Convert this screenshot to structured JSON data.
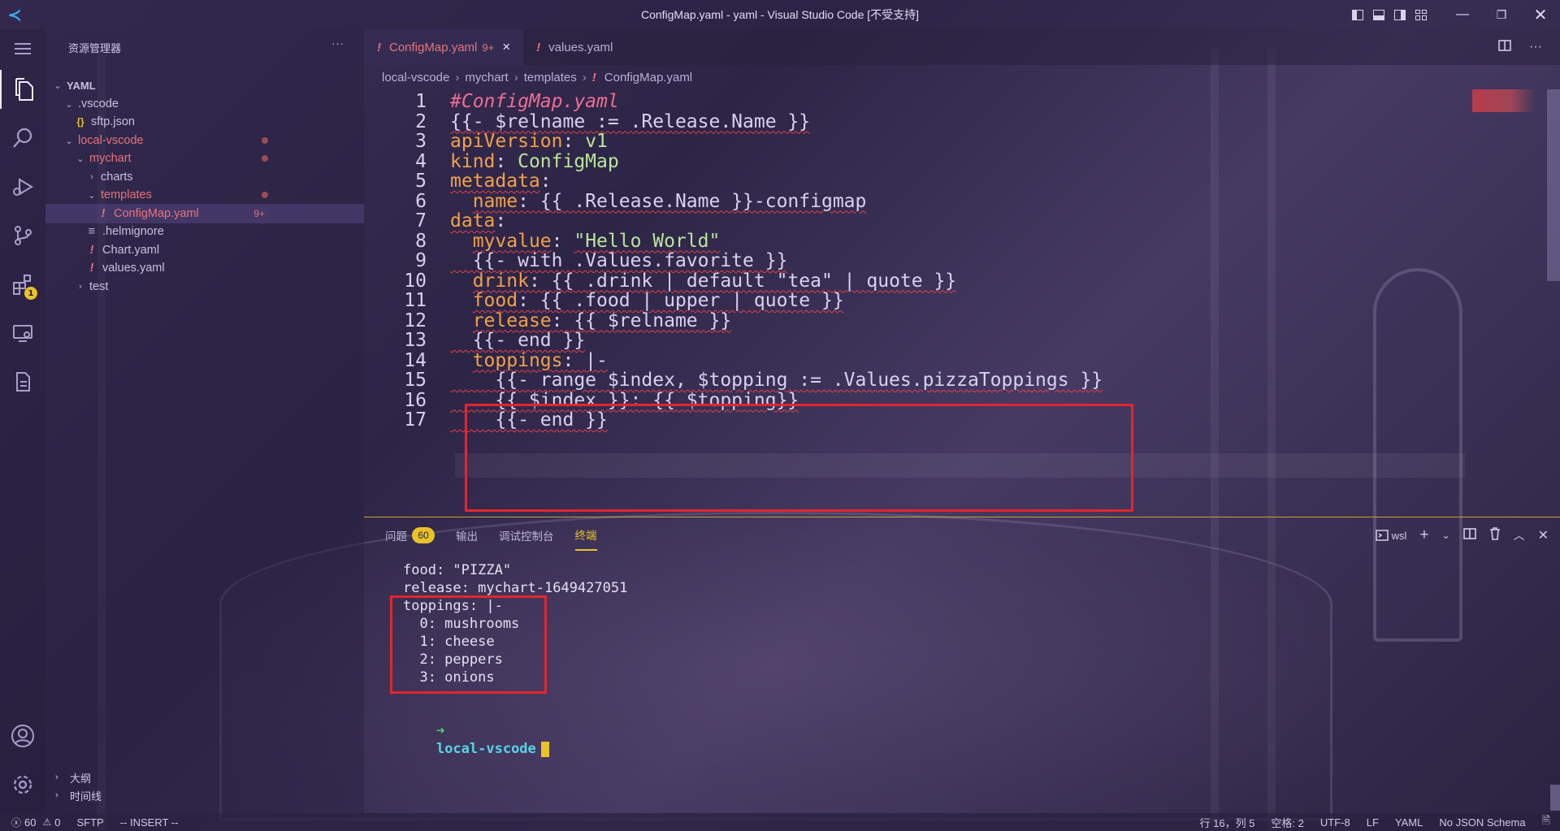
{
  "window": {
    "title": "ConfigMap.yaml - yaml - Visual Studio Code [不受支持]"
  },
  "sidebar": {
    "header": "资源管理器",
    "more": "···",
    "tree": [
      {
        "label": "YAML",
        "chevron": "down"
      },
      {
        "label": ".vscode",
        "chevron": "down"
      },
      {
        "label": "sftp.json",
        "icon": "{}"
      },
      {
        "label": "local-vscode",
        "chevron": "down",
        "modified": true
      },
      {
        "label": "mychart",
        "chevron": "down",
        "modified": true
      },
      {
        "label": "charts",
        "chevron": "right"
      },
      {
        "label": "templates",
        "chevron": "down",
        "modified": true
      },
      {
        "label": "ConfigMap.yaml",
        "icon": "!",
        "count": "9+"
      },
      {
        "label": ".helmignore",
        "icon": "≡"
      },
      {
        "label": "Chart.yaml",
        "icon": "!"
      },
      {
        "label": "values.yaml",
        "icon": "!"
      },
      {
        "label": "test",
        "chevron": "right"
      }
    ],
    "outline": "大纲",
    "timeline": "时间线"
  },
  "activity": {
    "extensions_badge": "1"
  },
  "tabs": [
    {
      "label": "ConfigMap.yaml",
      "modified": "9+",
      "close": "×"
    },
    {
      "label": "values.yaml"
    }
  ],
  "breadcrumb": [
    "local-vscode",
    "mychart",
    "templates",
    "ConfigMap.yaml"
  ],
  "code": {
    "line_numbers": [
      "1",
      "2",
      "3",
      "4",
      "5",
      "6",
      "7",
      "8",
      "9",
      "10",
      "11",
      "12",
      "13",
      "14",
      "15",
      "16",
      "17"
    ],
    "lines": [
      [
        {
          "c": "cmt",
          "t": "#ConfigMap.yaml"
        }
      ],
      [
        {
          "c": "t",
          "t": "{{- $relname := .Release.Name }}",
          "sq": true
        }
      ],
      [
        {
          "c": "k",
          "t": "apiVersion"
        },
        {
          "c": "t",
          "t": ": "
        },
        {
          "c": "v",
          "t": "v1"
        }
      ],
      [
        {
          "c": "k",
          "t": "kind"
        },
        {
          "c": "t",
          "t": ": "
        },
        {
          "c": "v",
          "t": "ConfigMap"
        }
      ],
      [
        {
          "c": "k",
          "t": "metadata",
          "sq": true
        },
        {
          "c": "t",
          "t": ":"
        }
      ],
      [
        {
          "c": "t",
          "t": "  "
        },
        {
          "c": "k",
          "t": "name",
          "sq": true
        },
        {
          "c": "t",
          "t": ": {{ .Release.Name }}-configmap",
          "sq": true
        }
      ],
      [
        {
          "c": "k",
          "t": "data",
          "sq": true
        },
        {
          "c": "t",
          "t": ":"
        }
      ],
      [
        {
          "c": "t",
          "t": "  "
        },
        {
          "c": "k",
          "t": "myvalue",
          "sq": true
        },
        {
          "c": "t",
          "t": ": "
        },
        {
          "c": "v",
          "t": "\"Hello World\"",
          "sq": true
        }
      ],
      [
        {
          "c": "t",
          "t": "  {{- with .Values.favorite }}",
          "sq": true
        }
      ],
      [
        {
          "c": "t",
          "t": "  "
        },
        {
          "c": "k",
          "t": "drink",
          "sq": true
        },
        {
          "c": "t",
          "t": ": {{ .drink | default \"tea\" | quote }}",
          "sq": true
        }
      ],
      [
        {
          "c": "t",
          "t": "  "
        },
        {
          "c": "k",
          "t": "food",
          "sq": true
        },
        {
          "c": "t",
          "t": ": {{ .food | upper | quote }}",
          "sq": true
        }
      ],
      [
        {
          "c": "t",
          "t": "  "
        },
        {
          "c": "k",
          "t": "release",
          "sq": true
        },
        {
          "c": "t",
          "t": ": {{ $relname }}",
          "sq": true
        }
      ],
      [
        {
          "c": "t",
          "t": "  {{- end }}",
          "sq": true
        }
      ],
      [
        {
          "c": "t",
          "t": "  "
        },
        {
          "c": "k",
          "t": "toppings",
          "sq": true
        },
        {
          "c": "t",
          "t": ": |-",
          "sq": true
        }
      ],
      [
        {
          "c": "t",
          "t": "    {{- range $index, $topping := .Values.pizzaToppings }}",
          "sq": true
        }
      ],
      [
        {
          "c": "t",
          "t": "    {{ $index }}: {{ $topping}}",
          "sq": true
        }
      ],
      [
        {
          "c": "t",
          "t": "    {{- end }}",
          "sq": true
        }
      ]
    ]
  },
  "panel": {
    "tabs": [
      {
        "label": "问题",
        "badge": "60"
      },
      {
        "label": "输出"
      },
      {
        "label": "调试控制台"
      },
      {
        "label": "终端",
        "active": true
      }
    ],
    "terminal_name": "wsl",
    "terminal_lines": [
      "food: \"PIZZA\"",
      "release: mychart-1649427051",
      "toppings: |-",
      "  0: mushrooms",
      "  1: cheese",
      "  2: peppers",
      "  3: onions"
    ],
    "prompt_arrow": "➜",
    "prompt_dir": "local-vscode"
  },
  "status": {
    "errors": "60",
    "warnings": "0",
    "sftp": "SFTP",
    "mode": "-- INSERT --",
    "position": "行 16，列 5",
    "spaces": "空格: 2",
    "encoding": "UTF-8",
    "eol": "LF",
    "language": "YAML",
    "schema": "No JSON Schema"
  },
  "colors": {
    "accent": "#e8c22a",
    "error": "#e2262c",
    "key": "#f2a04a",
    "string": "#b9e59a"
  }
}
